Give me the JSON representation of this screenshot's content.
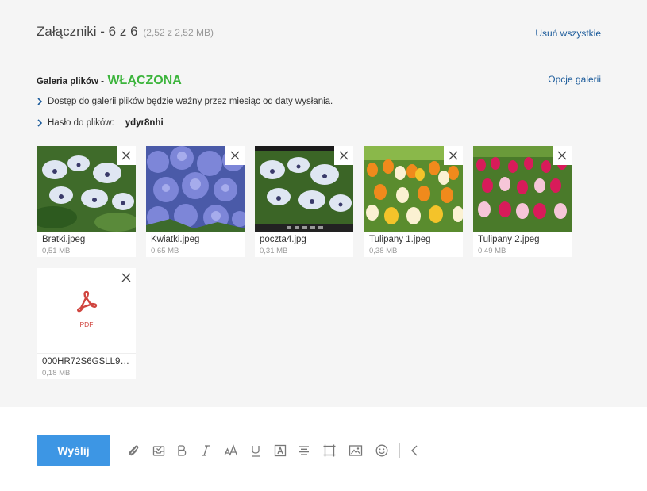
{
  "attachments": {
    "title": "Załączniki - 6 z 6",
    "size_info": "(2,52 z 2,52 MB)",
    "remove_all": "Usuń wszystkie"
  },
  "gallery": {
    "label": "Galeria plików -",
    "status": "WŁĄCZONA",
    "options": "Opcje galerii",
    "access_info": "Dostęp do galerii plików będzie ważny przez miesiąc od daty wysłania.",
    "password_label": "Hasło do plików:",
    "password_value": "ydyr8nhi"
  },
  "files": [
    {
      "name": "Bratki.jpeg",
      "size": "0,51 MB",
      "kind": "pansy-white"
    },
    {
      "name": "Kwiatki.jpeg",
      "size": "0,65 MB",
      "kind": "blue-flowers"
    },
    {
      "name": "poczta4.jpg",
      "size": "0,31 MB",
      "kind": "pansy-white-dark"
    },
    {
      "name": "Tulipany 1.jpeg",
      "size": "0,38 MB",
      "kind": "tulips-orange"
    },
    {
      "name": "Tulipany 2.jpeg",
      "size": "0,49 MB",
      "kind": "tulips-pink"
    },
    {
      "name": "000HR72S6GSLL9G...",
      "size": "0,18 MB",
      "kind": "pdf",
      "type_label": "PDF"
    }
  ],
  "toolbar": {
    "send_label": "Wyślij",
    "icons": [
      "paperclip-icon",
      "inbox-check-icon",
      "bold-icon",
      "italic-icon",
      "font-size-icon",
      "underline-icon",
      "text-color-icon",
      "align-center-icon",
      "crop-icon",
      "image-icon",
      "emoji-icon",
      "chevron-left-icon"
    ]
  },
  "colors": {
    "accent": "#3d96e4",
    "link": "#1a5a9a",
    "status_on": "#3cb43c",
    "pdf_red": "#d0453f"
  }
}
